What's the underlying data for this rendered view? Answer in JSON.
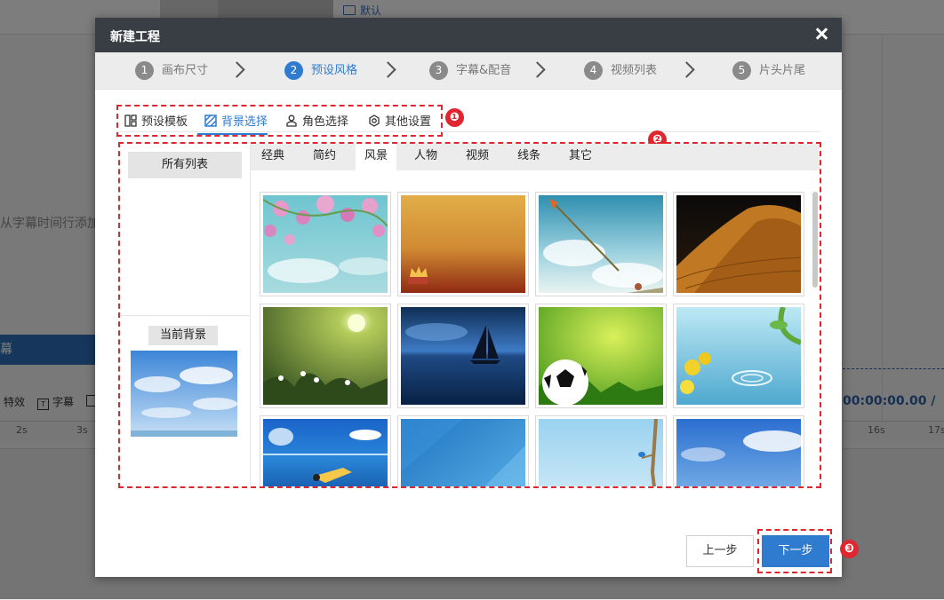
{
  "background": {
    "default_label": "默认",
    "hint_text": "从字幕时间行添加",
    "blue_bar_label": "幕",
    "tools": [
      "特效",
      "字幕"
    ],
    "ruler_ticks": [
      "2s",
      "3s",
      "16s",
      "17s"
    ],
    "timecode": "00:00:00.00 /"
  },
  "dialog": {
    "title": "新建工程",
    "steps": [
      {
        "num": "1",
        "label": "画布尺寸"
      },
      {
        "num": "2",
        "label": "预设风格"
      },
      {
        "num": "3",
        "label": "字幕&配音"
      },
      {
        "num": "4",
        "label": "视频列表"
      },
      {
        "num": "5",
        "label": "片头片尾"
      }
    ],
    "active_step": 2,
    "subtabs": [
      {
        "label": "预设模板",
        "icon": "layout-icon"
      },
      {
        "label": "背景选择",
        "icon": "background-icon"
      },
      {
        "label": "角色选择",
        "icon": "person-icon"
      },
      {
        "label": "其他设置",
        "icon": "settings-icon"
      }
    ],
    "active_subtab": "背景选择",
    "badges": [
      "❶",
      "❷",
      "❸"
    ],
    "left_panel": {
      "all_list": "所有列表",
      "current_bg_label": "当前背景"
    },
    "categories": [
      "经典",
      "简约",
      "风景",
      "人物",
      "视频",
      "线条",
      "其它"
    ],
    "active_category": "风景",
    "thumbnails": [
      "pink-blossoms-sky",
      "gold-crown-gradient",
      "arrow-sky",
      "desert-dunes",
      "green-sun-grass",
      "sailboat-sea",
      "soccer-grass",
      "yellow-flowers-water",
      "diver-underwater",
      "blue-abstract",
      "bird-branch-sky",
      "blue-sky-clouds"
    ],
    "footer": {
      "prev_label": "上一步",
      "next_label": "下一步"
    }
  },
  "colors": {
    "accent": "#2f7bd0",
    "header_bg": "#393d44",
    "highlight_red": "#e0262e"
  }
}
